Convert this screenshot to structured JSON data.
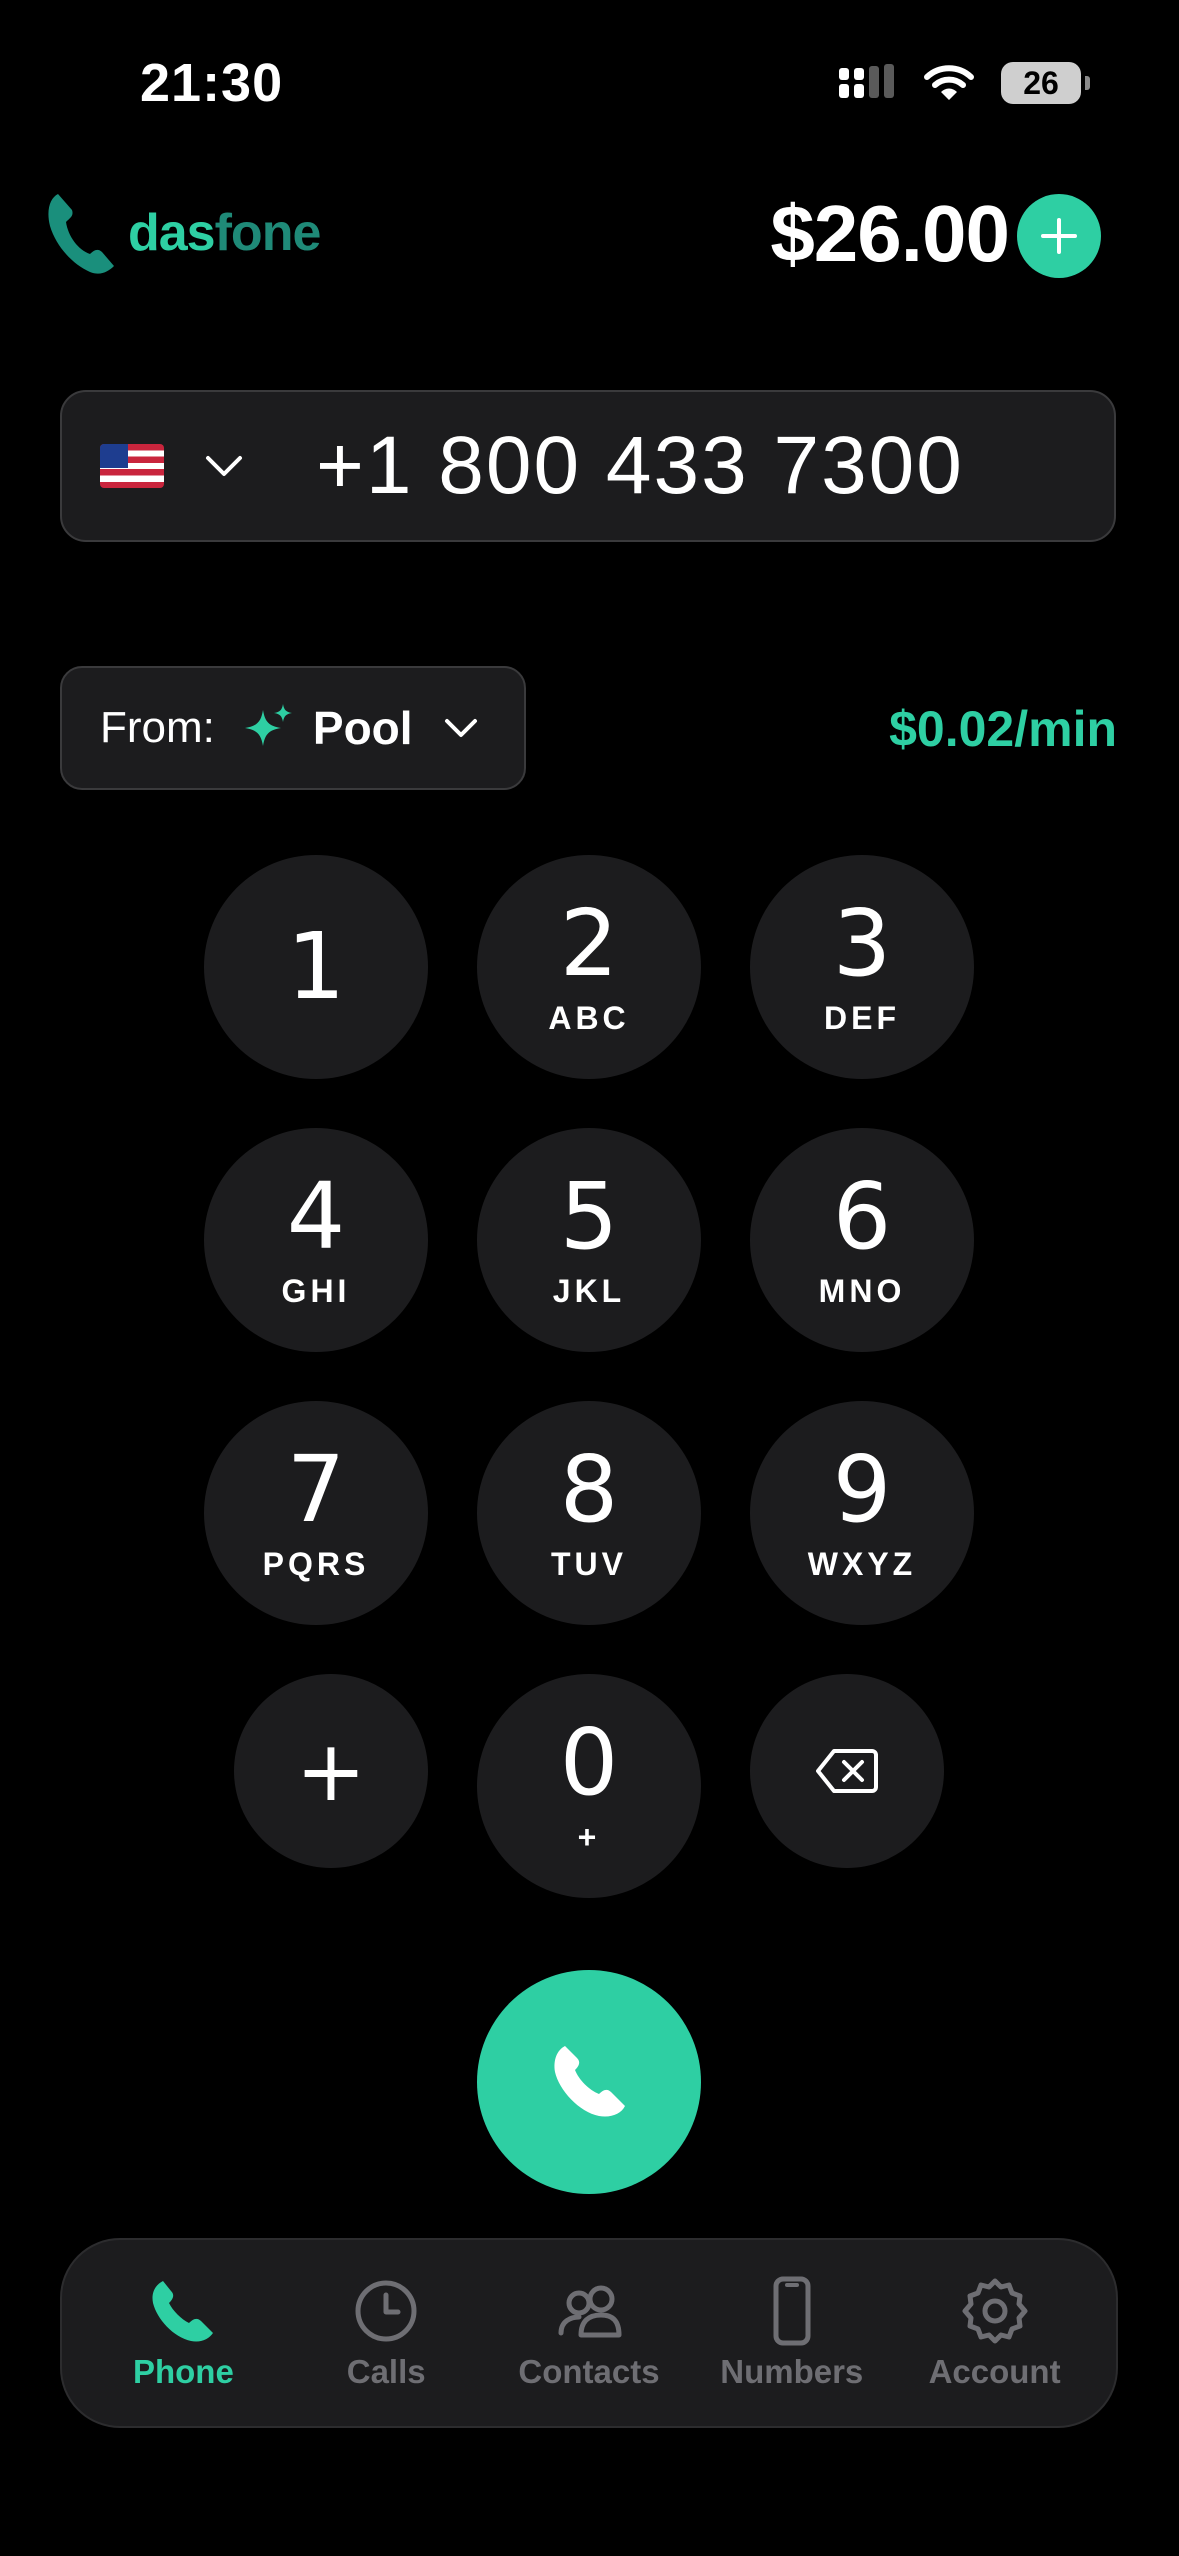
{
  "status_bar": {
    "time": "21:30",
    "battery": "26"
  },
  "header": {
    "logo_part1": "das",
    "logo_part2": "fone",
    "balance": "$26.00"
  },
  "dialer": {
    "country_flag": "us-flag-icon",
    "phone_number": "+1 800 433 7300",
    "from_label": "From:",
    "from_value": "Pool",
    "rate": "$0.02/min"
  },
  "keypad": [
    {
      "digit": "1",
      "letters": ""
    },
    {
      "digit": "2",
      "letters": "ABC"
    },
    {
      "digit": "3",
      "letters": "DEF"
    },
    {
      "digit": "4",
      "letters": "GHI"
    },
    {
      "digit": "5",
      "letters": "JKL"
    },
    {
      "digit": "6",
      "letters": "MNO"
    },
    {
      "digit": "7",
      "letters": "PQRS"
    },
    {
      "digit": "8",
      "letters": "TUV"
    },
    {
      "digit": "9",
      "letters": "WXYZ"
    },
    {
      "digit": "0",
      "letters": "+"
    }
  ],
  "plus_key": "+",
  "tabs": [
    {
      "label": "Phone",
      "icon": "phone-icon",
      "active": true
    },
    {
      "label": "Calls",
      "icon": "clock-icon",
      "active": false
    },
    {
      "label": "Contacts",
      "icon": "people-icon",
      "active": false
    },
    {
      "label": "Numbers",
      "icon": "mobile-device-icon",
      "active": false
    },
    {
      "label": "Account",
      "icon": "gear-icon",
      "active": false
    }
  ],
  "colors": {
    "accent": "#2ecfa3",
    "surface": "#1c1c1e",
    "background": "#000000",
    "inactive": "#6e6e73"
  }
}
